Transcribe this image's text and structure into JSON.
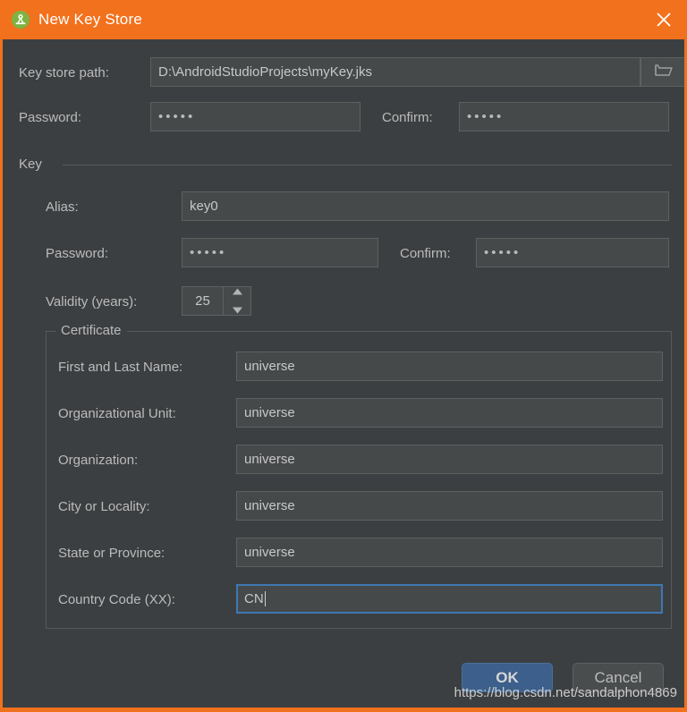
{
  "window": {
    "title": "New Key Store",
    "app_icon": "android-studio-icon",
    "close_icon": "close-icon",
    "accent_color": "#f2711c",
    "background_color": "#3c3f41"
  },
  "keystore": {
    "path_label": "Key store path:",
    "path_value": "D:\\AndroidStudioProjects\\myKey.jks",
    "browse_icon": "folder-open-icon",
    "password_label": "Password:",
    "password_value": "•••••",
    "confirm_label": "Confirm:",
    "confirm_value": "•••••"
  },
  "key_group": {
    "title": "Key",
    "alias_label": "Alias:",
    "alias_value": "key0",
    "password_label": "Password:",
    "password_value": "•••••",
    "confirm_label": "Confirm:",
    "confirm_value": "•••••",
    "validity_label": "Validity (years):",
    "validity_value": "25",
    "spinner_up_icon": "chevron-up-icon",
    "spinner_down_icon": "chevron-down-icon"
  },
  "certificate": {
    "title": "Certificate",
    "fields": [
      {
        "label": "First and Last Name:",
        "value": "universe",
        "focused": false
      },
      {
        "label": "Organizational Unit:",
        "value": "universe",
        "focused": false
      },
      {
        "label": "Organization:",
        "value": "universe",
        "focused": false
      },
      {
        "label": "City or Locality:",
        "value": "universe",
        "focused": false
      },
      {
        "label": "State or Province:",
        "value": "universe",
        "focused": false
      },
      {
        "label": "Country Code (XX):",
        "value": "CN",
        "focused": true
      }
    ]
  },
  "buttons": {
    "ok_label": "OK",
    "cancel_label": "Cancel",
    "ok_color": "#3c5f8b"
  },
  "watermark": {
    "text": "https://blog.csdn.net/sandalphon4869"
  }
}
